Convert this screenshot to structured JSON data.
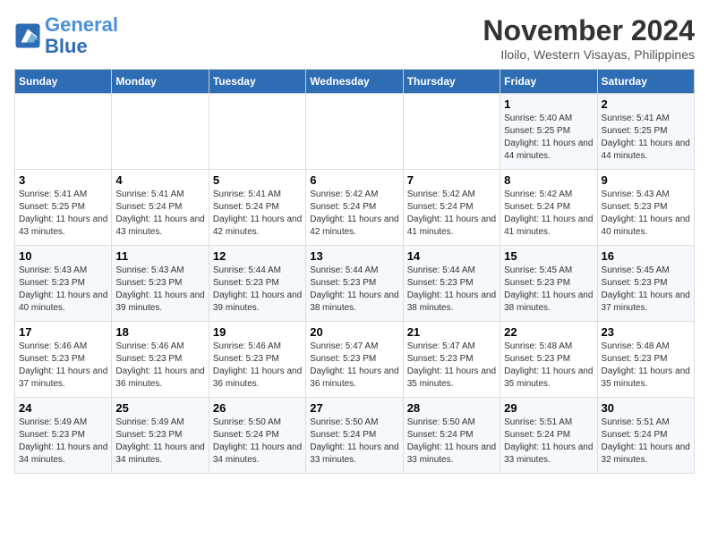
{
  "header": {
    "logo_line1": "General",
    "logo_line2": "Blue",
    "month": "November 2024",
    "location": "Iloilo, Western Visayas, Philippines"
  },
  "weekdays": [
    "Sunday",
    "Monday",
    "Tuesday",
    "Wednesday",
    "Thursday",
    "Friday",
    "Saturday"
  ],
  "weeks": [
    [
      {
        "day": "",
        "info": ""
      },
      {
        "day": "",
        "info": ""
      },
      {
        "day": "",
        "info": ""
      },
      {
        "day": "",
        "info": ""
      },
      {
        "day": "",
        "info": ""
      },
      {
        "day": "1",
        "info": "Sunrise: 5:40 AM\nSunset: 5:25 PM\nDaylight: 11 hours and 44 minutes."
      },
      {
        "day": "2",
        "info": "Sunrise: 5:41 AM\nSunset: 5:25 PM\nDaylight: 11 hours and 44 minutes."
      }
    ],
    [
      {
        "day": "3",
        "info": "Sunrise: 5:41 AM\nSunset: 5:25 PM\nDaylight: 11 hours and 43 minutes."
      },
      {
        "day": "4",
        "info": "Sunrise: 5:41 AM\nSunset: 5:24 PM\nDaylight: 11 hours and 43 minutes."
      },
      {
        "day": "5",
        "info": "Sunrise: 5:41 AM\nSunset: 5:24 PM\nDaylight: 11 hours and 42 minutes."
      },
      {
        "day": "6",
        "info": "Sunrise: 5:42 AM\nSunset: 5:24 PM\nDaylight: 11 hours and 42 minutes."
      },
      {
        "day": "7",
        "info": "Sunrise: 5:42 AM\nSunset: 5:24 PM\nDaylight: 11 hours and 41 minutes."
      },
      {
        "day": "8",
        "info": "Sunrise: 5:42 AM\nSunset: 5:24 PM\nDaylight: 11 hours and 41 minutes."
      },
      {
        "day": "9",
        "info": "Sunrise: 5:43 AM\nSunset: 5:23 PM\nDaylight: 11 hours and 40 minutes."
      }
    ],
    [
      {
        "day": "10",
        "info": "Sunrise: 5:43 AM\nSunset: 5:23 PM\nDaylight: 11 hours and 40 minutes."
      },
      {
        "day": "11",
        "info": "Sunrise: 5:43 AM\nSunset: 5:23 PM\nDaylight: 11 hours and 39 minutes."
      },
      {
        "day": "12",
        "info": "Sunrise: 5:44 AM\nSunset: 5:23 PM\nDaylight: 11 hours and 39 minutes."
      },
      {
        "day": "13",
        "info": "Sunrise: 5:44 AM\nSunset: 5:23 PM\nDaylight: 11 hours and 38 minutes."
      },
      {
        "day": "14",
        "info": "Sunrise: 5:44 AM\nSunset: 5:23 PM\nDaylight: 11 hours and 38 minutes."
      },
      {
        "day": "15",
        "info": "Sunrise: 5:45 AM\nSunset: 5:23 PM\nDaylight: 11 hours and 38 minutes."
      },
      {
        "day": "16",
        "info": "Sunrise: 5:45 AM\nSunset: 5:23 PM\nDaylight: 11 hours and 37 minutes."
      }
    ],
    [
      {
        "day": "17",
        "info": "Sunrise: 5:46 AM\nSunset: 5:23 PM\nDaylight: 11 hours and 37 minutes."
      },
      {
        "day": "18",
        "info": "Sunrise: 5:46 AM\nSunset: 5:23 PM\nDaylight: 11 hours and 36 minutes."
      },
      {
        "day": "19",
        "info": "Sunrise: 5:46 AM\nSunset: 5:23 PM\nDaylight: 11 hours and 36 minutes."
      },
      {
        "day": "20",
        "info": "Sunrise: 5:47 AM\nSunset: 5:23 PM\nDaylight: 11 hours and 36 minutes."
      },
      {
        "day": "21",
        "info": "Sunrise: 5:47 AM\nSunset: 5:23 PM\nDaylight: 11 hours and 35 minutes."
      },
      {
        "day": "22",
        "info": "Sunrise: 5:48 AM\nSunset: 5:23 PM\nDaylight: 11 hours and 35 minutes."
      },
      {
        "day": "23",
        "info": "Sunrise: 5:48 AM\nSunset: 5:23 PM\nDaylight: 11 hours and 35 minutes."
      }
    ],
    [
      {
        "day": "24",
        "info": "Sunrise: 5:49 AM\nSunset: 5:23 PM\nDaylight: 11 hours and 34 minutes."
      },
      {
        "day": "25",
        "info": "Sunrise: 5:49 AM\nSunset: 5:23 PM\nDaylight: 11 hours and 34 minutes."
      },
      {
        "day": "26",
        "info": "Sunrise: 5:50 AM\nSunset: 5:24 PM\nDaylight: 11 hours and 34 minutes."
      },
      {
        "day": "27",
        "info": "Sunrise: 5:50 AM\nSunset: 5:24 PM\nDaylight: 11 hours and 33 minutes."
      },
      {
        "day": "28",
        "info": "Sunrise: 5:50 AM\nSunset: 5:24 PM\nDaylight: 11 hours and 33 minutes."
      },
      {
        "day": "29",
        "info": "Sunrise: 5:51 AM\nSunset: 5:24 PM\nDaylight: 11 hours and 33 minutes."
      },
      {
        "day": "30",
        "info": "Sunrise: 5:51 AM\nSunset: 5:24 PM\nDaylight: 11 hours and 32 minutes."
      }
    ]
  ]
}
